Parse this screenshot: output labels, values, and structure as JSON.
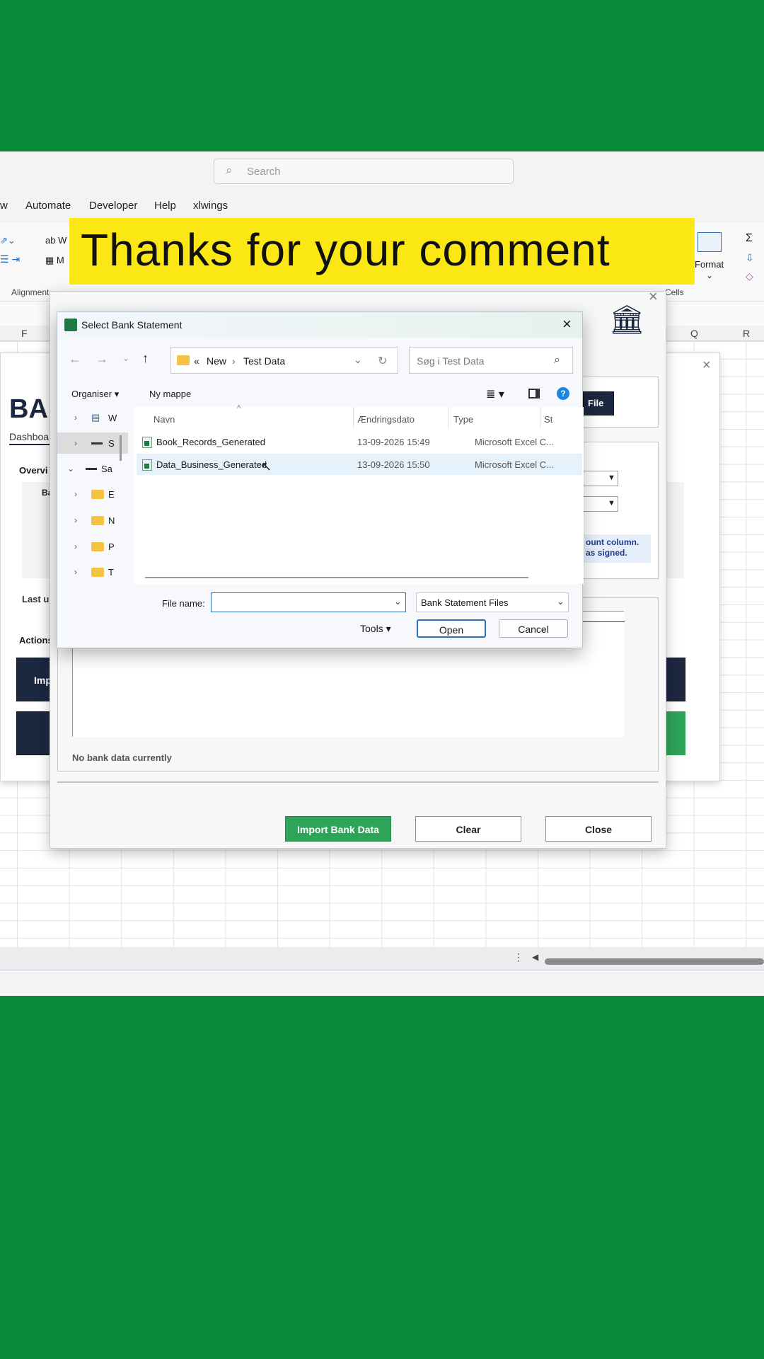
{
  "overlay_caption": "Thanks for your comment",
  "excel": {
    "search_placeholder": "Search",
    "menu": [
      "w",
      "Automate",
      "Developer",
      "Help",
      "xlwings"
    ],
    "ribbon": {
      "alignment_label": "Alignment",
      "cells_label": "Cells",
      "format_label": "Format",
      "wrap_fragment": "W",
      "merge_fragment": "M"
    },
    "columns": [
      "F",
      "Q",
      "R"
    ]
  },
  "dashboard": {
    "title_fragment": "BA",
    "tab_fragment": "Dashboa",
    "overview_fragment": "Overvi",
    "card_fragment": "Ba",
    "last_fragment": "Last u",
    "actions_fragment": "Actions",
    "import_fragment": "Imp"
  },
  "bank_form": {
    "file_button_fragment": "File",
    "note_line1": "ount column.",
    "note_line2": "as signed.",
    "no_data": "No bank data currently",
    "import_button": "Import Bank Data",
    "clear_button": "Clear",
    "close_button": "Close"
  },
  "file_dialog": {
    "title": "Select Bank Statement",
    "breadcrumb": {
      "prefix": "«",
      "parent": "New",
      "current": "Test Data"
    },
    "search_placeholder": "Søg i Test Data",
    "organise": "Organiser",
    "new_folder": "Ny mappe",
    "columns": {
      "name": "Navn",
      "date": "Ændringsdato",
      "type": "Type",
      "size": "St"
    },
    "files": [
      {
        "name": "Book_Records_Generated",
        "date": "13-09-2026 15:49",
        "type": "Microsoft Excel C..."
      },
      {
        "name": "Data_Business_Generated",
        "date": "13-09-2026 15:50",
        "type": "Microsoft Excel C..."
      }
    ],
    "tree": [
      "W",
      "S",
      "Sa",
      "E",
      "N",
      "P",
      "T"
    ],
    "file_name_label": "File name:",
    "file_name_value": "",
    "filter": "Bank Statement Files",
    "tools": "Tools",
    "open_button": "Open",
    "cancel_button": "Cancel"
  }
}
